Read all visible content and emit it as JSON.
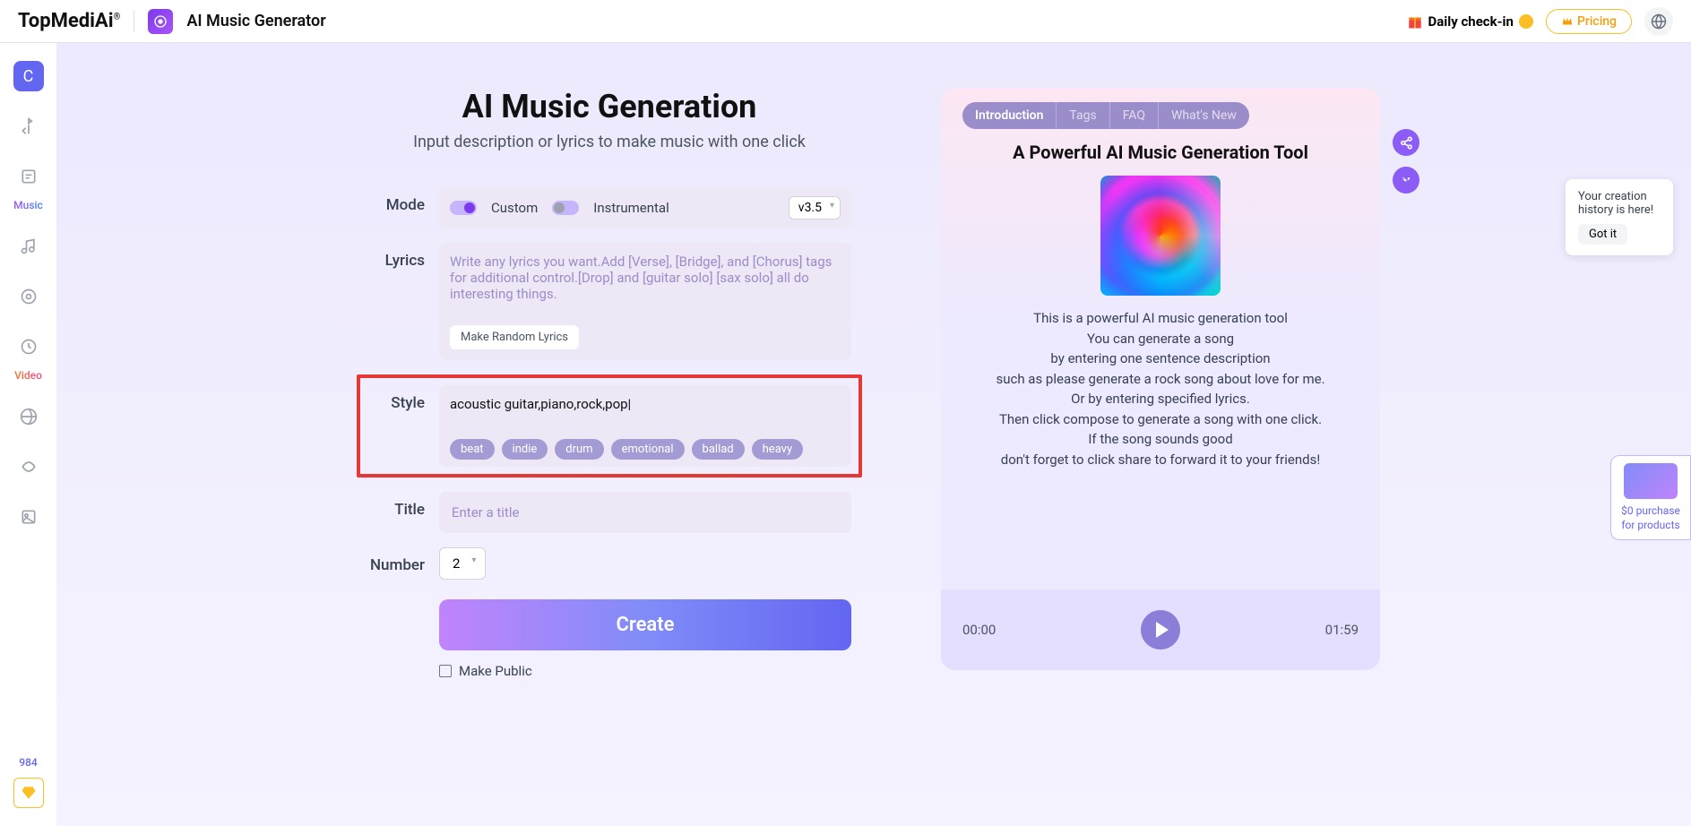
{
  "header": {
    "logo": "TopMediAi",
    "logo_sup": "®",
    "app_title": "AI Music Generator",
    "checkin_label": "Daily check-in",
    "pricing_label": "Pricing"
  },
  "sidebar": {
    "music_label": "Music",
    "video_label": "Video",
    "credits": "984"
  },
  "main": {
    "title": "AI Music Generation",
    "subtitle": "Input description or lyrics to make music with one click",
    "mode_label": "Mode",
    "custom_label": "Custom",
    "instrumental_label": "Instrumental",
    "version": "v3.5",
    "lyrics_label": "Lyrics",
    "lyrics_placeholder": "Write any lyrics you want.Add [Verse], [Bridge], and [Chorus] tags for additional control.[Drop] and [guitar solo] [sax solo] all do interesting things.",
    "random_lyrics_label": "Make Random Lyrics",
    "style_label": "Style",
    "style_value": "acoustic guitar,piano,rock,pop|",
    "style_tags": [
      "beat",
      "indie",
      "drum",
      "emotional",
      "ballad",
      "heavy"
    ],
    "title_label": "Title",
    "title_placeholder": "Enter a title",
    "number_label": "Number",
    "number_value": "2",
    "create_label": "Create",
    "public_label": "Make Public"
  },
  "panel": {
    "tabs": [
      "Introduction",
      "Tags",
      "FAQ",
      "What's New"
    ],
    "title": "A Powerful AI Music Generation Tool",
    "desc_lines": [
      "This is a powerful AI music generation tool",
      "You can generate a song",
      "by entering one sentence description",
      "such as please generate a rock song about love for me.",
      "Or by entering specified lyrics.",
      "Then click compose to generate a song with one click.",
      "If the song sounds good",
      "don't forget to click share to forward it to your friends!"
    ],
    "time_start": "00:00",
    "time_end": "01:59"
  },
  "tooltip": {
    "text": "Your creation history is here!",
    "btn": "Got it"
  },
  "promo": {
    "line1": "$0 purchase",
    "line2": "for products"
  }
}
